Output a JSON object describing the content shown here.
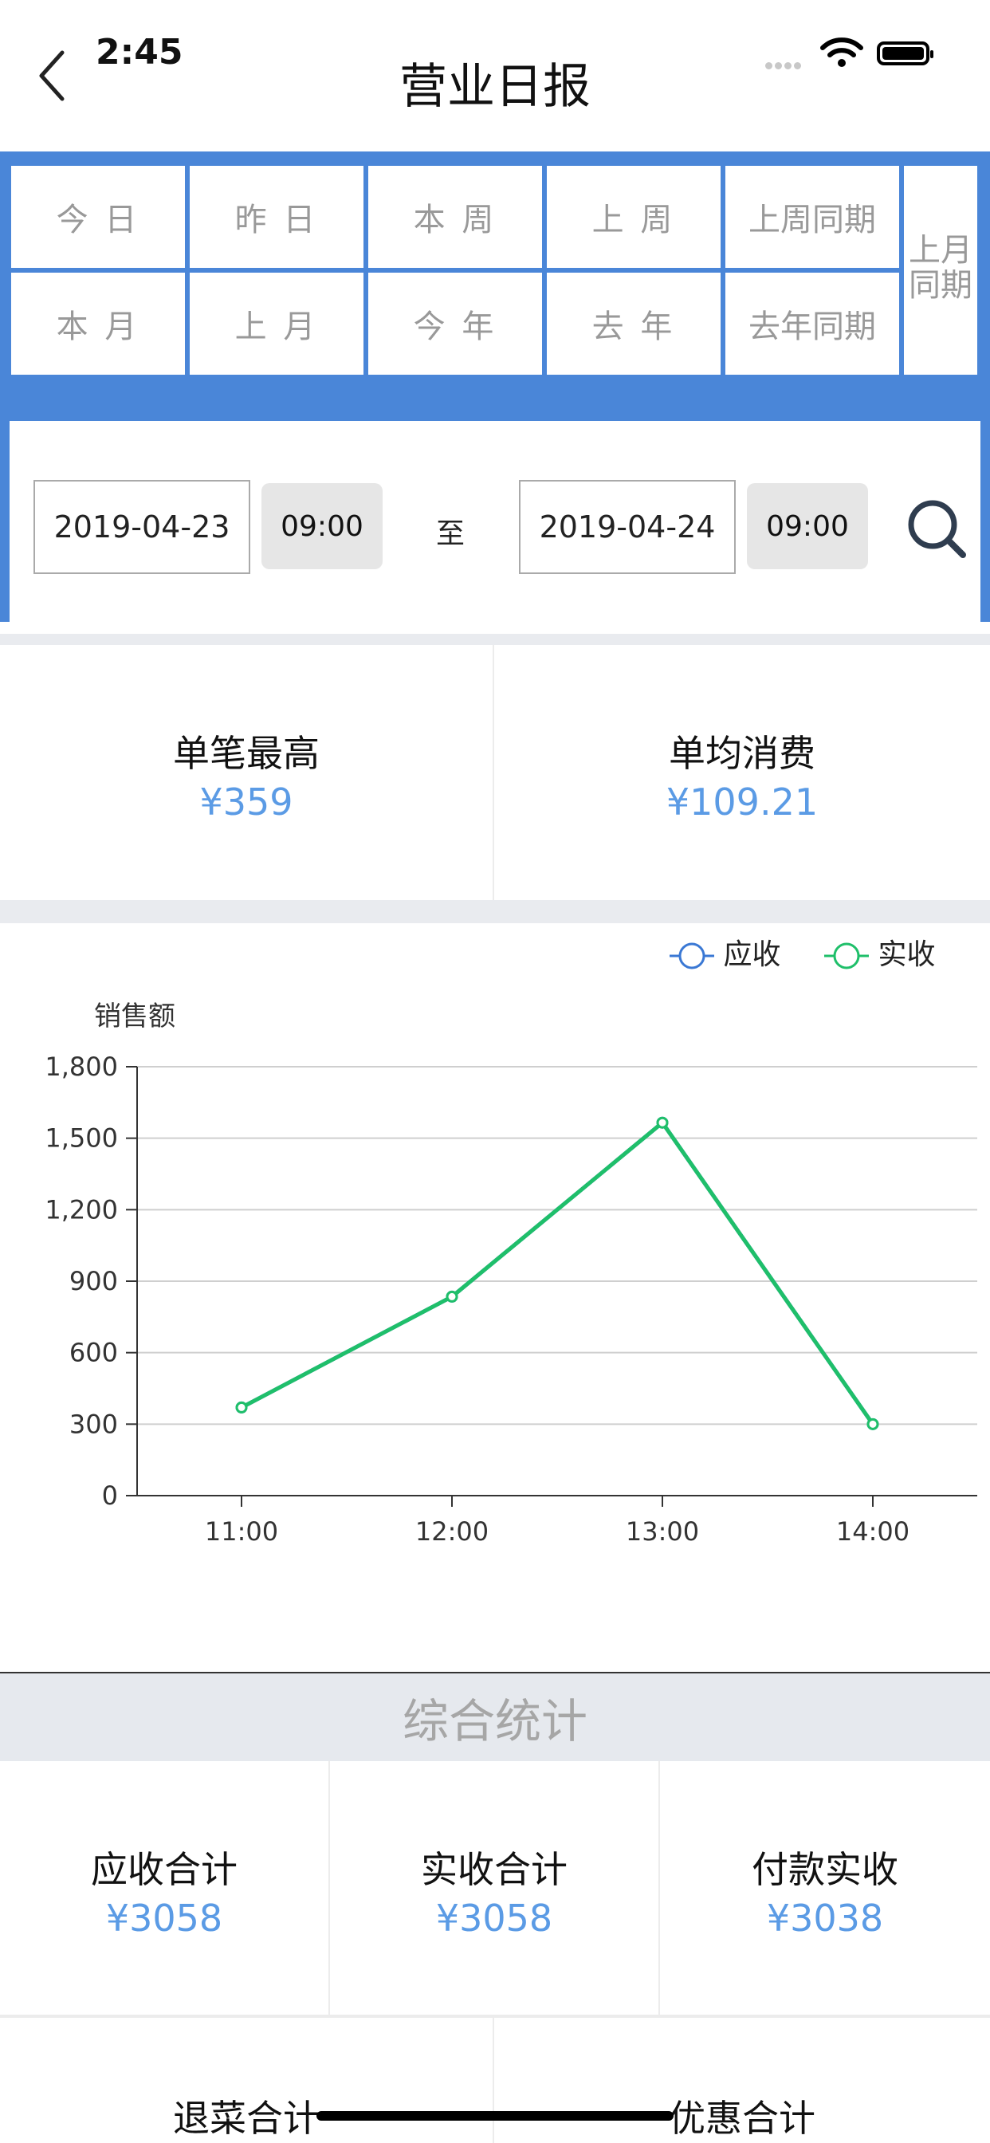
{
  "status_bar": {
    "time": "2:45"
  },
  "header": {
    "title": "营业日报"
  },
  "quick_filters": {
    "row1": [
      "今 日",
      "昨 日",
      "本 周",
      "上 周",
      "上周同期"
    ],
    "row2": [
      "本 月",
      "上 月",
      "今 年",
      "去 年",
      "去年同期"
    ],
    "side": [
      "上月",
      "同期"
    ]
  },
  "date_range": {
    "start_date": "2019-04-23",
    "start_time": "09:00",
    "separator": "至",
    "end_date": "2019-04-24",
    "end_time": "09:00"
  },
  "top_stats": [
    {
      "label": "单笔最高",
      "value": "¥359"
    },
    {
      "label": "单均消费",
      "value": "¥109.21"
    }
  ],
  "legend": [
    "应收",
    "实收"
  ],
  "colors": {
    "accent_blue": "#4a86d8",
    "value_blue": "#5b9be5",
    "series_blue": "#3a78d4",
    "series_green": "#1fbf6a"
  },
  "chart_data": {
    "type": "line",
    "ylabel": "销售额",
    "x": [
      "11:00",
      "12:00",
      "13:00",
      "14:00"
    ],
    "y_ticks": [
      "0",
      "300",
      "600",
      "900",
      "1,200",
      "1,500",
      "1,800"
    ],
    "ylim": [
      0,
      1800
    ],
    "grid": true,
    "legend_position": "top-right",
    "series": [
      {
        "name": "应收",
        "values": [
          370,
          835,
          1565,
          300
        ]
      },
      {
        "name": "实收",
        "values": [
          370,
          835,
          1565,
          300
        ]
      }
    ]
  },
  "section": {
    "title": "综合统计"
  },
  "summary_stats": [
    {
      "label": "应收合计",
      "value": "¥3058"
    },
    {
      "label": "实收合计",
      "value": "¥3058"
    },
    {
      "label": "付款实收",
      "value": "¥3038"
    }
  ],
  "more_stats": [
    {
      "label": "退菜合计"
    },
    {
      "label": "优惠合计"
    }
  ]
}
